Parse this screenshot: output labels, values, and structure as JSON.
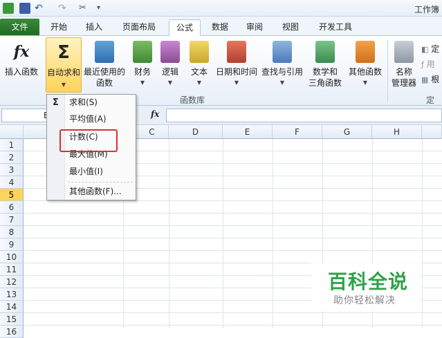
{
  "window": {
    "title": "工作簿"
  },
  "tabs": [
    {
      "label": "文件"
    },
    {
      "label": "开始"
    },
    {
      "label": "插入"
    },
    {
      "label": "页面布局"
    },
    {
      "label": "公式"
    },
    {
      "label": "数据"
    },
    {
      "label": "审阅"
    },
    {
      "label": "视图"
    },
    {
      "label": "开发工具"
    }
  ],
  "ribbon": {
    "insert_function": "插入函数",
    "autosum": "自动求和",
    "recent_1": "最近使用的",
    "recent_2": "函数",
    "financial": "财务",
    "logical": "逻辑",
    "text": "文本",
    "datetime": "日期和时间",
    "lookup": "查找与引用",
    "math_1": "数学和",
    "math_2": "三角函数",
    "more": "其他函数",
    "name_mgr_1": "名称",
    "name_mgr_2": "管理器",
    "side_1": "定",
    "side_2": "用",
    "side_3": "根",
    "group_label": "函数库",
    "group_label_2": "定义"
  },
  "formula_bar": {
    "namebox": "E",
    "fx": "fx"
  },
  "columns": [
    "C",
    "D",
    "E",
    "F",
    "G",
    "H"
  ],
  "rows": [
    "1",
    "2",
    "3",
    "4",
    "5",
    "6",
    "7",
    "8",
    "9",
    "10",
    "11",
    "12",
    "13",
    "14",
    "15",
    "16"
  ],
  "selected_row": "5",
  "menu": {
    "sigma": "Σ",
    "items": [
      "求和(S)",
      "平均值(A)",
      "计数(C)",
      "最大值(M)",
      "最小值(I)",
      "其他函数(F)..."
    ]
  },
  "watermark": {
    "title": "百科全说",
    "subtitle": "助你轻松解决"
  },
  "colors": {
    "accent": "#1e6b23",
    "highlight": "#d9312b",
    "selection": "#ffd35a"
  }
}
